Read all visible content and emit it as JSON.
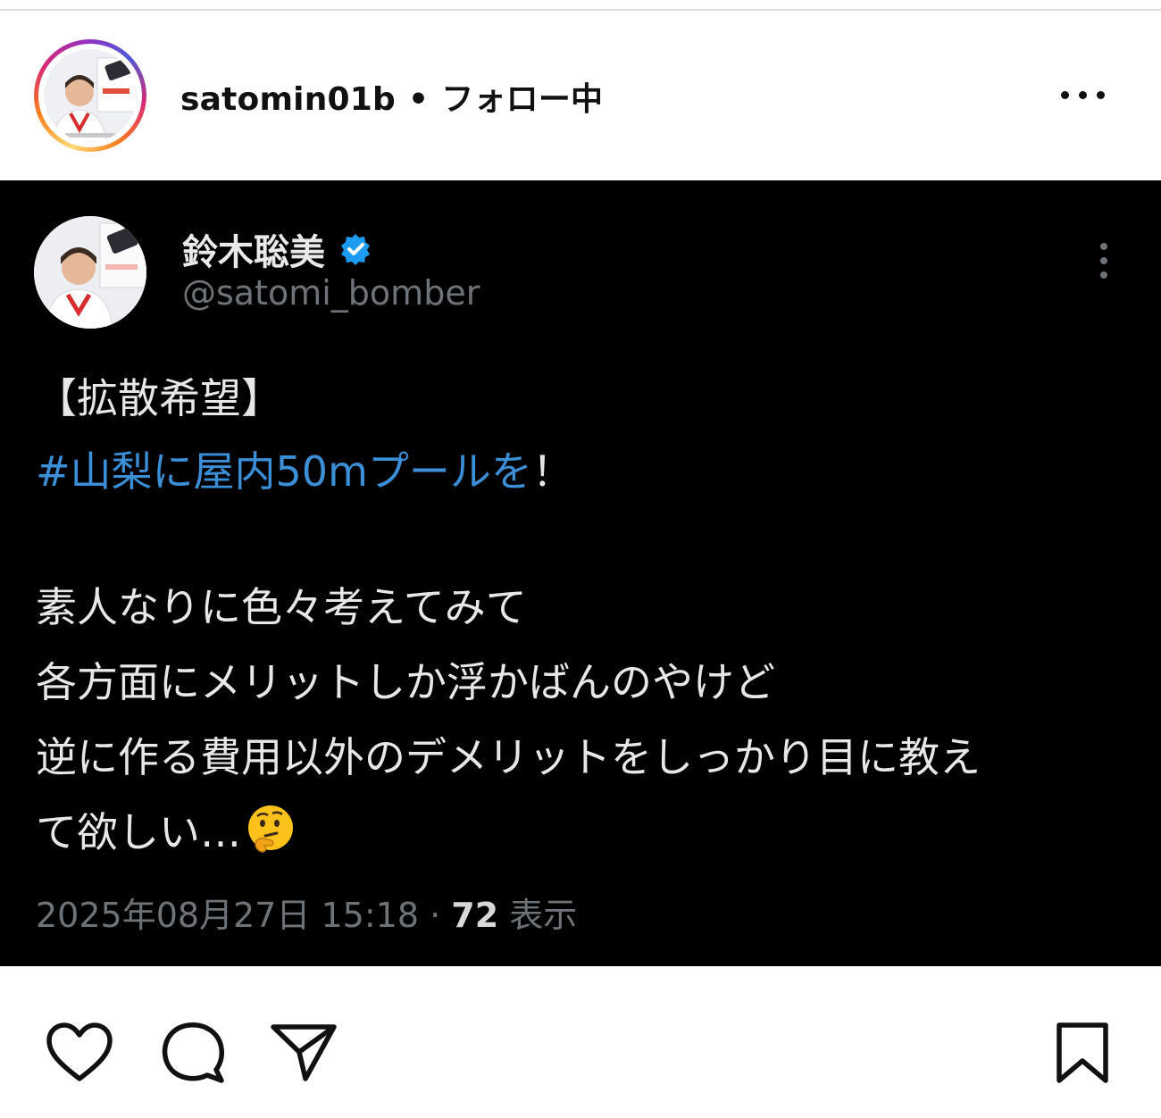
{
  "header": {
    "username": "satomin01b",
    "separator": "•",
    "follow_status": "フォロー中",
    "more_icon": "more-horizontal-icon"
  },
  "post": {
    "author": {
      "display_name": "鈴木聡美",
      "handle": "@satomi_bomber",
      "verified": true,
      "verified_color": "#1d9bf0"
    },
    "lines": [
      {
        "text": "【拡散希望】",
        "type": "plain"
      },
      {
        "hashtag": "#山梨に屋内50mプールを",
        "suffix": "！",
        "type": "hashtag"
      },
      {
        "text": "素人なりに色々考えてみて",
        "type": "plain"
      },
      {
        "text": "各方面にメリットしか浮かばんのやけど",
        "type": "plain"
      },
      {
        "text": "逆に作る費用以外のデメリットをしっかり目に教え",
        "type": "plain"
      },
      {
        "text": "て欲しい…",
        "emoji": "thinking-face-emoji",
        "type": "plain"
      }
    ],
    "meta": {
      "timestamp": "2025年08月27日 15:18",
      "separator": "·",
      "view_count": "72",
      "view_label": "表示"
    },
    "colors": {
      "background": "#000000",
      "text": "#e7e7e7",
      "hashtag": "#3b8fd6",
      "muted": "#6e7378"
    }
  },
  "actions": {
    "like_icon": "heart-icon",
    "comment_icon": "comment-icon",
    "share_icon": "send-icon",
    "save_icon": "bookmark-icon"
  }
}
